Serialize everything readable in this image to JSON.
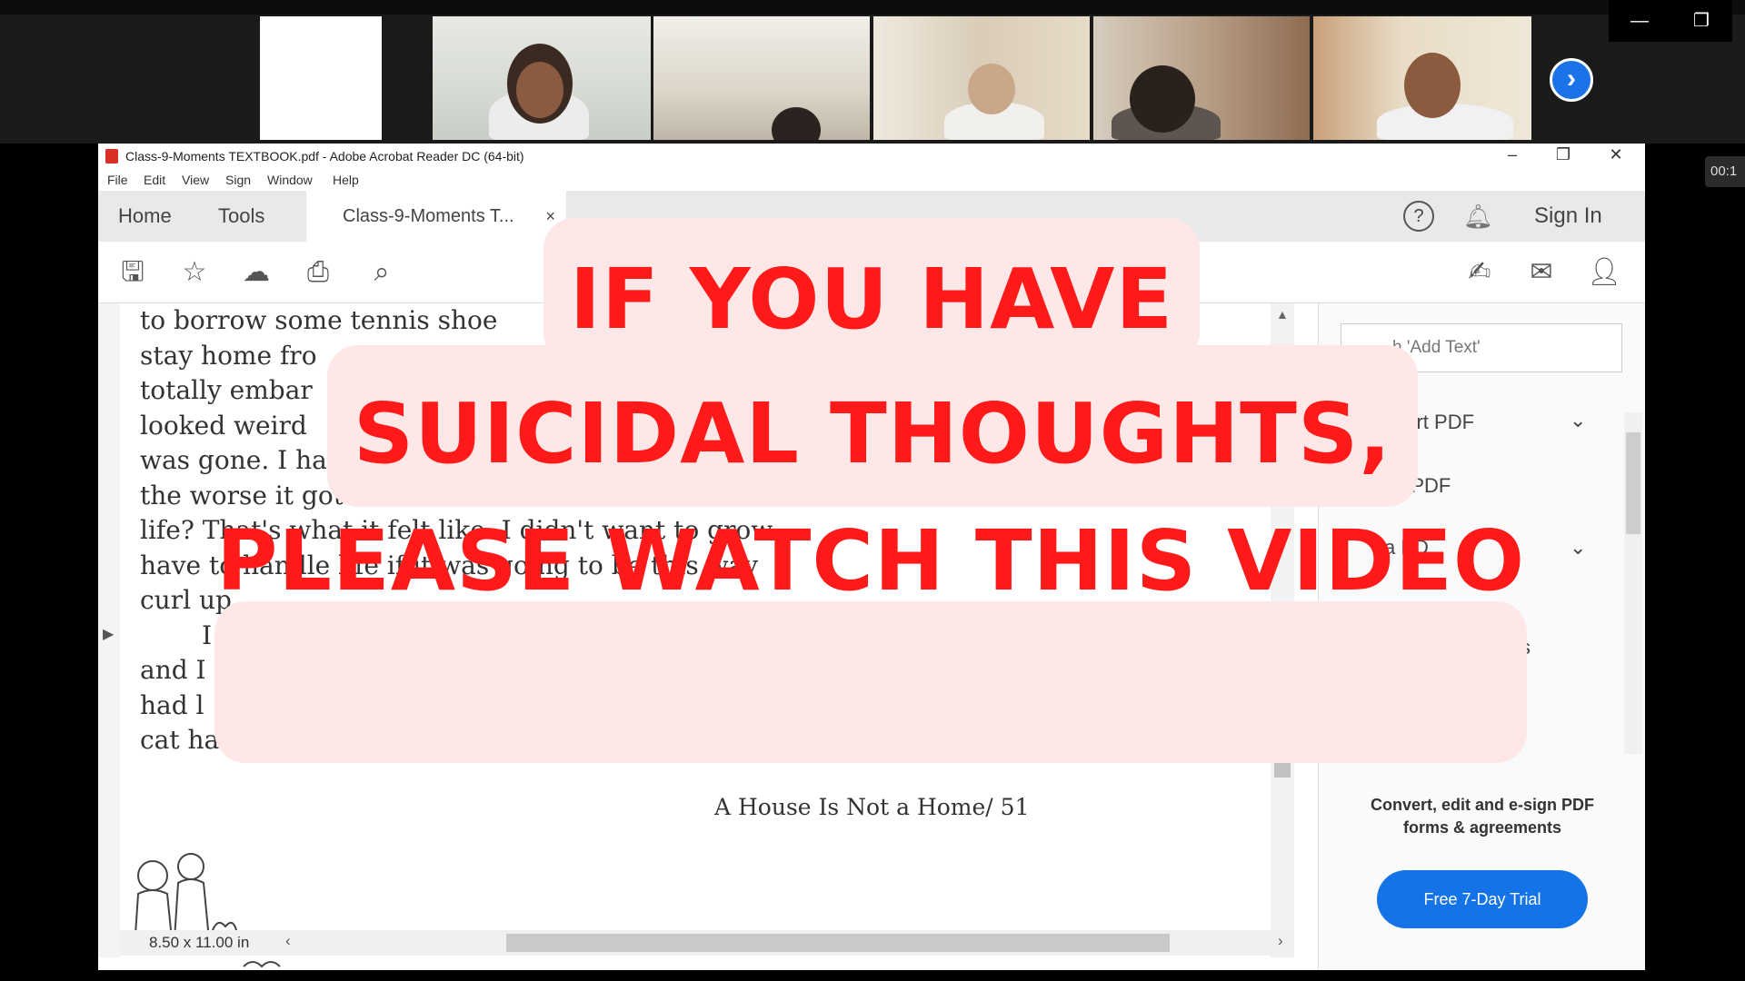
{
  "zoom": {
    "next_icon": "chevron-right-icon",
    "minimize_icon": "minimize-icon",
    "restore_icon": "restore-icon",
    "timer": "00:1"
  },
  "acrobat": {
    "window_title": "Class-9-Moments TEXTBOOK.pdf - Adobe Acrobat Reader DC (64-bit)",
    "menu": [
      "File",
      "Edit",
      "View",
      "Sign",
      "Window",
      "Help"
    ],
    "tabs": {
      "home": "Home",
      "tools": "Tools",
      "document": "Class-9-Moments T...",
      "close": "×"
    },
    "help_icon": "?",
    "sign_in": "Sign In",
    "toolbar_icons": [
      "save-icon",
      "star-icon",
      "cloud-upload-icon",
      "print-icon",
      "zoom-out-icon"
    ],
    "toolbar_right_icons": [
      "sign-icon",
      "mail-icon",
      "add-user-icon"
    ]
  },
  "document": {
    "lines": [
      "to borrow some tennis shoe",
      "stay home fro",
      "totally embar",
      "looked weird",
      "was gone. I ha",
      "the worse it got. Was I destined to be an outcast",
      "life? That's what it felt like. I didn't want to grow",
      "have to handle life if it was going to be this way",
      "curl up",
      "I",
      "and I",
      "had l",
      "cat ha"
    ],
    "footer": "A House Is Not a Home/ 51",
    "page_size": "8.50 x 11.00 in"
  },
  "right_pane": {
    "search_placeholder": "h 'Add Text'",
    "items": [
      "xport PDF",
      "dit PDF",
      "a PD",
      "s"
    ],
    "promo_line1": "Convert, edit and e-sign PDF",
    "promo_line2": "forms & agreements",
    "trial_button": "Free 7-Day Trial"
  },
  "overlay": {
    "line1": "IF YOU HAVE",
    "line2": "SUICIDAL THOUGHTS,",
    "line3": "PLEASE WATCH THIS VIDEO",
    "text_color": "#ff1a1a",
    "background_color": "#fde7e7"
  }
}
